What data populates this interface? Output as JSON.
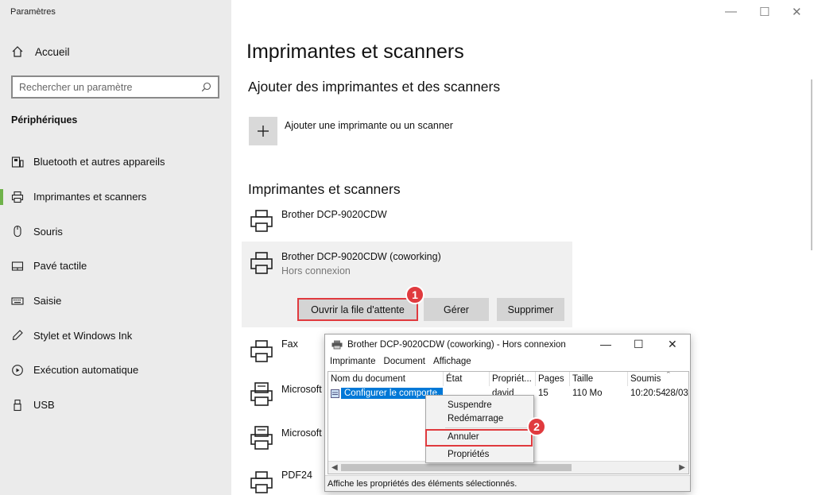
{
  "app": {
    "title": "Paramètres"
  },
  "sidebar": {
    "home_label": "Accueil",
    "search_placeholder": "Rechercher un paramètre",
    "section_title": "Périphériques",
    "items": [
      {
        "label": "Bluetooth et autres appareils",
        "icon": "bluetooth-devices-icon"
      },
      {
        "label": "Imprimantes et scanners",
        "icon": "printer-icon",
        "active": true
      },
      {
        "label": "Souris",
        "icon": "mouse-icon"
      },
      {
        "label": "Pavé tactile",
        "icon": "touchpad-icon"
      },
      {
        "label": "Saisie",
        "icon": "keyboard-icon"
      },
      {
        "label": "Stylet et Windows Ink",
        "icon": "pen-icon"
      },
      {
        "label": "Exécution automatique",
        "icon": "autoplay-icon"
      },
      {
        "label": "USB",
        "icon": "usb-icon"
      }
    ]
  },
  "main": {
    "title": "Imprimantes et scanners",
    "add_section_title": "Ajouter des imprimantes et des scanners",
    "add_label": "Ajouter une imprimante ou un scanner",
    "list_section_title": "Imprimantes et scanners",
    "printers": [
      {
        "name": "Brother DCP-9020CDW"
      },
      {
        "name": "Brother DCP-9020CDW (coworking)",
        "status": "Hors connexion"
      },
      {
        "name": "Fax"
      },
      {
        "name": "Microsoft"
      },
      {
        "name": "Microsoft"
      },
      {
        "name": "PDF24"
      }
    ],
    "actions": {
      "open_queue": "Ouvrir la file d'attente",
      "manage": "Gérer",
      "remove": "Supprimer"
    }
  },
  "badges": {
    "one": "1",
    "two": "2"
  },
  "queue_window": {
    "title": "Brother DCP-9020CDW (coworking) - Hors connexion",
    "menu": [
      "Imprimante",
      "Document",
      "Affichage"
    ],
    "columns": [
      "Nom du document",
      "État",
      "Propriét...",
      "Pages",
      "Taille",
      "Soumis"
    ],
    "row": {
      "document": "Configurer le comporte...",
      "owner": "david",
      "pages": "15",
      "size": "110 Mo",
      "submitted_time": "10:20:54",
      "submitted_date": "28/03/"
    },
    "status_bar": "Affiche les propriétés des éléments sélectionnés."
  },
  "context_menu": {
    "items": [
      "Suspendre",
      "Redémarrage",
      "Annuler",
      "Propriétés"
    ]
  },
  "colors": {
    "accent": "#6fb24a",
    "highlight": "#e03a3e",
    "selection": "#0078d7"
  }
}
